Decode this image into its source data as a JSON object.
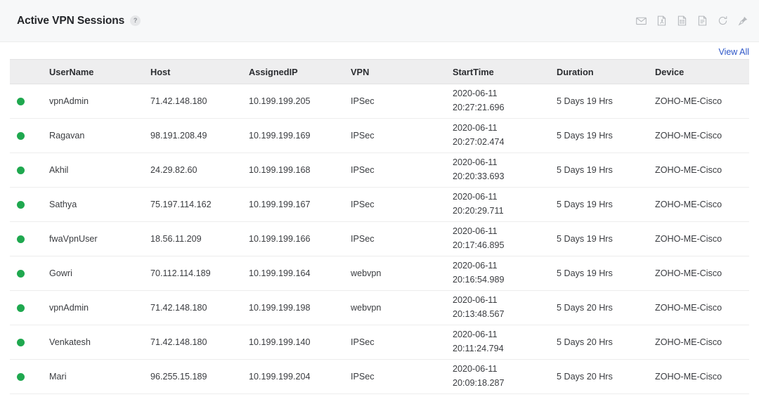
{
  "header": {
    "title": "Active VPN Sessions",
    "help_badge": "?",
    "tools": [
      {
        "name": "email-icon",
        "label": "Email"
      },
      {
        "name": "pdf-export-icon",
        "label": "Export as PDF"
      },
      {
        "name": "excel-export-icon",
        "label": "Export as XLS"
      },
      {
        "name": "csv-export-icon",
        "label": "Export as CSV"
      },
      {
        "name": "refresh-icon",
        "label": "Refresh"
      },
      {
        "name": "pin-icon",
        "label": "Pin"
      }
    ]
  },
  "actions": {
    "view_all": "View All"
  },
  "colors": {
    "status_active": "#1fa84f",
    "link": "#2d56c8",
    "header_row_bg": "#eeeeef",
    "widget_header_bg": "#f7f8f9"
  },
  "table": {
    "columns": [
      "",
      "UserName",
      "Host",
      "AssignedIP",
      "VPN",
      "StartTime",
      "Duration",
      "Device"
    ],
    "rows": [
      {
        "status": "active",
        "username": "vpnAdmin",
        "host": "71.42.148.180",
        "assigned_ip": "10.199.199.205",
        "vpn": "IPSec",
        "start_date": "2020-06-11",
        "start_time": "20:27:21.696",
        "duration": "5 Days 19 Hrs",
        "device": "ZOHO-ME-Cisco"
      },
      {
        "status": "active",
        "username": "Ragavan",
        "host": "98.191.208.49",
        "assigned_ip": "10.199.199.169",
        "vpn": "IPSec",
        "start_date": "2020-06-11",
        "start_time": "20:27:02.474",
        "duration": "5 Days 19 Hrs",
        "device": "ZOHO-ME-Cisco"
      },
      {
        "status": "active",
        "username": "Akhil",
        "host": "24.29.82.60",
        "assigned_ip": "10.199.199.168",
        "vpn": "IPSec",
        "start_date": "2020-06-11",
        "start_time": "20:20:33.693",
        "duration": "5 Days 19 Hrs",
        "device": "ZOHO-ME-Cisco"
      },
      {
        "status": "active",
        "username": "Sathya",
        "host": "75.197.114.162",
        "assigned_ip": "10.199.199.167",
        "vpn": "IPSec",
        "start_date": "2020-06-11",
        "start_time": "20:20:29.711",
        "duration": "5 Days 19 Hrs",
        "device": "ZOHO-ME-Cisco"
      },
      {
        "status": "active",
        "username": "fwaVpnUser",
        "host": "18.56.11.209",
        "assigned_ip": "10.199.199.166",
        "vpn": "IPSec",
        "start_date": "2020-06-11",
        "start_time": "20:17:46.895",
        "duration": "5 Days 19 Hrs",
        "device": "ZOHO-ME-Cisco"
      },
      {
        "status": "active",
        "username": "Gowri",
        "host": "70.112.114.189",
        "assigned_ip": "10.199.199.164",
        "vpn": "webvpn",
        "start_date": "2020-06-11",
        "start_time": "20:16:54.989",
        "duration": "5 Days 19 Hrs",
        "device": "ZOHO-ME-Cisco"
      },
      {
        "status": "active",
        "username": "vpnAdmin",
        "host": "71.42.148.180",
        "assigned_ip": "10.199.199.198",
        "vpn": "webvpn",
        "start_date": "2020-06-11",
        "start_time": "20:13:48.567",
        "duration": "5 Days 20 Hrs",
        "device": "ZOHO-ME-Cisco"
      },
      {
        "status": "active",
        "username": "Venkatesh",
        "host": "71.42.148.180",
        "assigned_ip": "10.199.199.140",
        "vpn": "IPSec",
        "start_date": "2020-06-11",
        "start_time": "20:11:24.794",
        "duration": "5 Days 20 Hrs",
        "device": "ZOHO-ME-Cisco"
      },
      {
        "status": "active",
        "username": "Mari",
        "host": "96.255.15.189",
        "assigned_ip": "10.199.199.204",
        "vpn": "IPSec",
        "start_date": "2020-06-11",
        "start_time": "20:09:18.287",
        "duration": "5 Days 20 Hrs",
        "device": "ZOHO-ME-Cisco"
      }
    ]
  }
}
